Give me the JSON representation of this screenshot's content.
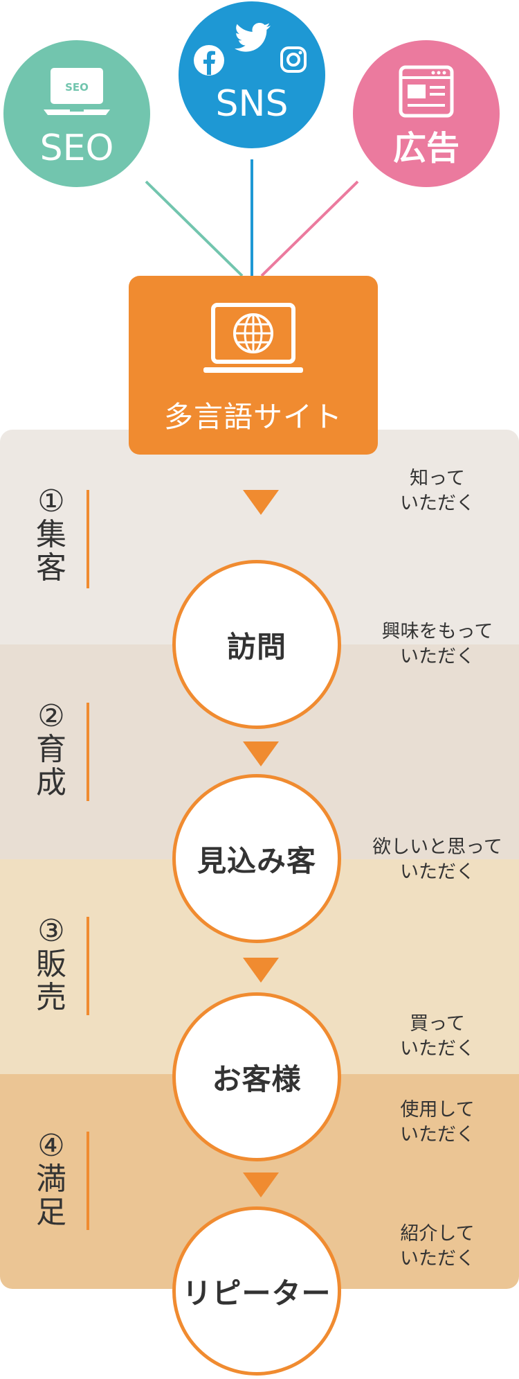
{
  "sources": [
    {
      "label": "SEO",
      "screen_text": "SEO",
      "color": "#72c5ae"
    },
    {
      "label": "SNS",
      "color": "#1e98d4",
      "icons": [
        "facebook-icon",
        "twitter-icon",
        "instagram-icon"
      ]
    },
    {
      "label": "広告",
      "color": "#eb7a9e",
      "icon": "browser-ad-icon"
    }
  ],
  "site": {
    "label": "多言語サイト",
    "icon": "laptop-globe-icon",
    "color": "#f08b30"
  },
  "stages": [
    {
      "label": "①集客",
      "color": "#ede8e3"
    },
    {
      "label": "②育成",
      "color": "#e8ded3"
    },
    {
      "label": "③販売",
      "color": "#f0dfc1"
    },
    {
      "label": "④満足",
      "color": "#ebc594"
    }
  ],
  "steps": [
    {
      "label": "訪問"
    },
    {
      "label": "見込み客"
    },
    {
      "label": "お客様"
    },
    {
      "label": "リピーター"
    }
  ],
  "actions": [
    {
      "line1": "知って",
      "line2": "いただく"
    },
    {
      "line1": "興味をもって",
      "line2": "いただく"
    },
    {
      "line1": "欲しいと思って",
      "line2": "いただく"
    },
    {
      "line1": "買って",
      "line2": "いただく"
    },
    {
      "line1": "使用して",
      "line2": "いただく"
    },
    {
      "line1": "紹介して",
      "line2": "いただく"
    }
  ],
  "accent_color": "#f08b30"
}
